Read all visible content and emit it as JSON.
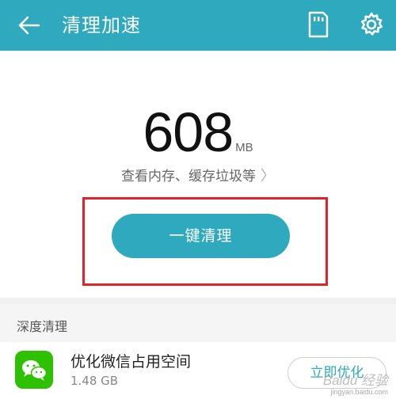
{
  "appbar": {
    "title": "清理加速",
    "back_icon": "back-arrow-icon",
    "sd_icon": "sd-card-icon",
    "settings_icon": "gear-icon",
    "color": "#2ea9bd"
  },
  "summary": {
    "size_value": "608",
    "size_unit": "MB",
    "detail_text": "查看内存、缓存垃圾等",
    "detail_chevron": "〉",
    "clean_button_label": "一键清理",
    "highlight_color": "#e0222b"
  },
  "deep_clean": {
    "section_title": "深度清理",
    "items": [
      {
        "icon": "wechat-icon",
        "name": "优化微信占用空间",
        "size": "1.48 GB",
        "action_label": "立即优化"
      }
    ]
  },
  "watermark": {
    "text": "Baidu 经验",
    "sub": "jingyan.baidu.com"
  }
}
